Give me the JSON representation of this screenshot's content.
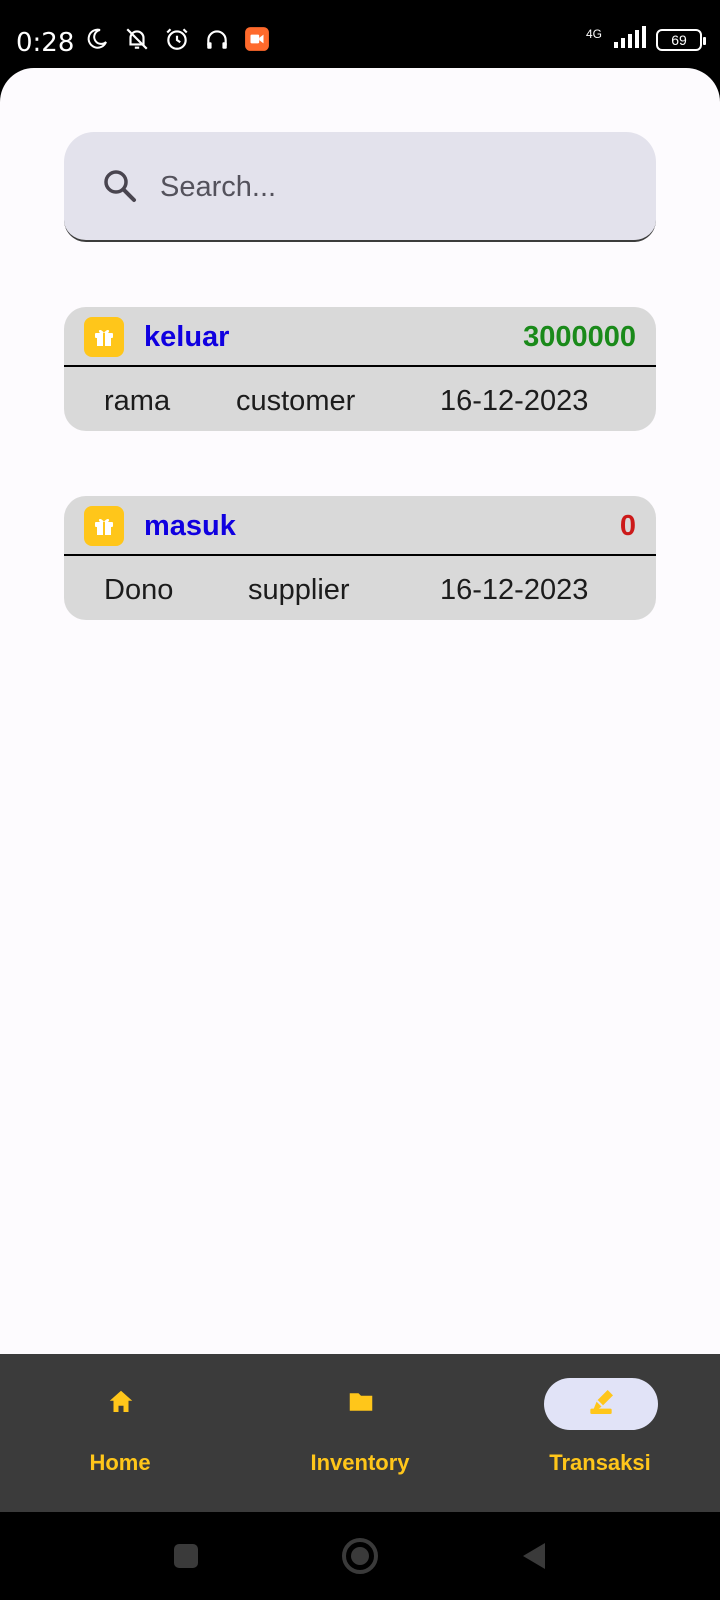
{
  "status_bar": {
    "time": "0:28",
    "network": "4G",
    "battery": "69"
  },
  "search": {
    "placeholder": "Search..."
  },
  "transactions": [
    {
      "type": "keluar",
      "amount": "3000000",
      "amount_color": "#1a8a1a",
      "name": "rama",
      "role": "customer",
      "date": "16-12-2023"
    },
    {
      "type": "masuk",
      "amount": "0",
      "amount_color": "#cc1a1a",
      "name": "Dono",
      "role": "supplier",
      "date": "16-12-2023"
    }
  ],
  "bottom_nav": {
    "items": [
      {
        "label": "Home",
        "icon": "home-icon",
        "active": false
      },
      {
        "label": "Inventory",
        "icon": "folder-icon",
        "active": false
      },
      {
        "label": "Transaksi",
        "icon": "edit-note-icon",
        "active": true
      }
    ]
  },
  "colors": {
    "accent": "#ffc61a",
    "type_text": "#1000e0",
    "nav_bg": "#3b3b3b",
    "active_pill": "#e1e3f7"
  }
}
